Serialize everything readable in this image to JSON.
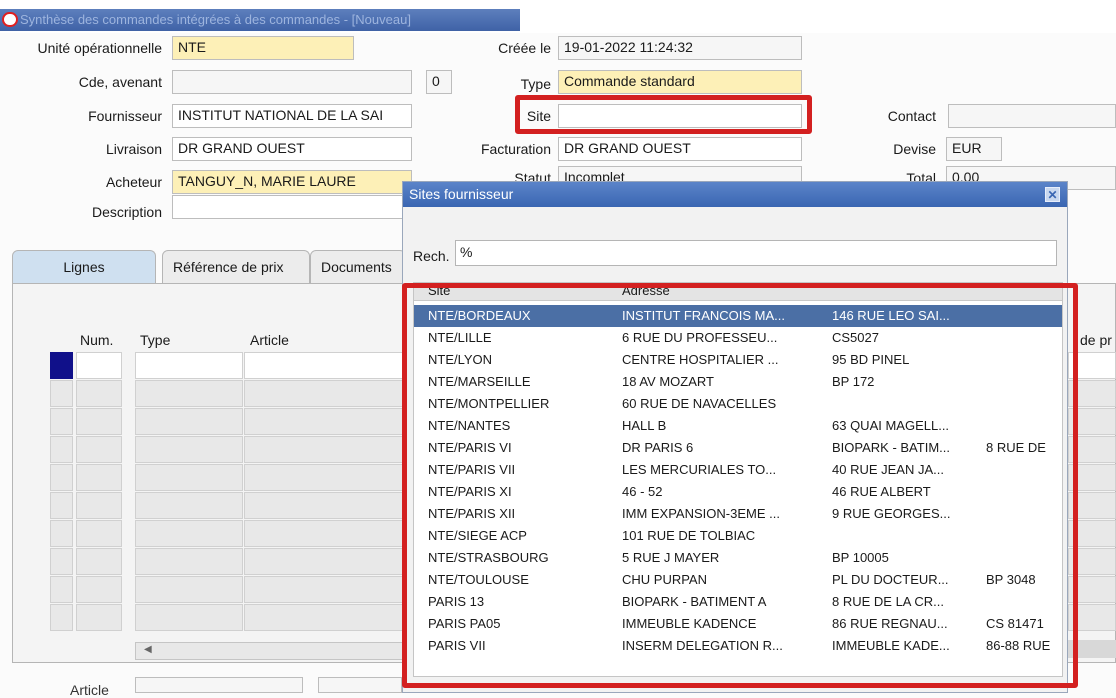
{
  "window": {
    "title": "Synthèse des commandes intégrées à des commandes - [Nouveau]"
  },
  "header": {
    "unite_label": "Unité opérationnelle",
    "unite_value": "NTE",
    "creee_label": "Créée le",
    "creee_value": "19-01-2022 11:24:32",
    "cde_label": "Cde, avenant",
    "cde_value": "",
    "avenant_value": "0",
    "type_label": "Type",
    "type_value": "Commande standard",
    "fournisseur_label": "Fournisseur",
    "fournisseur_value": "INSTITUT NATIONAL DE LA SAI",
    "site_label": "Site",
    "site_value": "",
    "contact_label": "Contact",
    "contact_value": "",
    "livraison_label": "Livraison",
    "livraison_value": "DR GRAND OUEST",
    "facturation_label": "Facturation",
    "facturation_value": "DR GRAND OUEST",
    "devise_label": "Devise",
    "devise_value": "EUR",
    "acheteur_label": "Acheteur",
    "acheteur_value": "TANGUY_N, MARIE LAURE",
    "statut_label": "Statut",
    "statut_value": "Incomplet",
    "total_label": "Total",
    "total_value": "0,00",
    "description_label": "Description",
    "description_value": ""
  },
  "tabs": [
    {
      "label": "Lignes"
    },
    {
      "label": "Référence de prix"
    },
    {
      "label": "Documents"
    }
  ],
  "grid": {
    "num": "Num.",
    "type": "Type",
    "article": "Article",
    "right_col": "de pr",
    "bottom_label": "Article"
  },
  "dialog": {
    "title": "Sites fournisseur",
    "search_label": "Rech.",
    "search_value": "%",
    "col_site": "Site",
    "col_adresse": "Adresse",
    "rows": [
      {
        "site": "NTE/BORDEAUX",
        "a1": "INSTITUT FRANCOIS MA...",
        "a2": "146 RUE LEO SAI...",
        "a3": ""
      },
      {
        "site": "NTE/LILLE",
        "a1": "6 RUE DU PROFESSEU...",
        "a2": "CS5027",
        "a3": ""
      },
      {
        "site": "NTE/LYON",
        "a1": "CENTRE HOSPITALIER ...",
        "a2": "95 BD PINEL",
        "a3": ""
      },
      {
        "site": "NTE/MARSEILLE",
        "a1": "18 AV MOZART",
        "a2": "BP 172",
        "a3": ""
      },
      {
        "site": "NTE/MONTPELLIER",
        "a1": "60 RUE DE NAVACELLES",
        "a2": "",
        "a3": ""
      },
      {
        "site": "NTE/NANTES",
        "a1": "HALL B",
        "a2": "63 QUAI MAGELL...",
        "a3": ""
      },
      {
        "site": "NTE/PARIS VI",
        "a1": "DR PARIS 6",
        "a2": "BIOPARK - BATIM...",
        "a3": "8 RUE DE"
      },
      {
        "site": "NTE/PARIS VII",
        "a1": "LES MERCURIALES TO...",
        "a2": "40 RUE JEAN JA...",
        "a3": ""
      },
      {
        "site": "NTE/PARIS XI",
        "a1": "46 - 52",
        "a2": "46 RUE ALBERT",
        "a3": ""
      },
      {
        "site": "NTE/PARIS XII",
        "a1": "IMM EXPANSION-3EME ...",
        "a2": "9 RUE GEORGES...",
        "a3": ""
      },
      {
        "site": "NTE/SIEGE ACP",
        "a1": "101 RUE DE TOLBIAC",
        "a2": "",
        "a3": ""
      },
      {
        "site": "NTE/STRASBOURG",
        "a1": "5 RUE J MAYER",
        "a2": "BP 10005",
        "a3": ""
      },
      {
        "site": "NTE/TOULOUSE",
        "a1": "CHU PURPAN",
        "a2": "PL DU DOCTEUR...",
        "a3": "BP 3048"
      },
      {
        "site": "PARIS 13",
        "a1": "BIOPARK - BATIMENT A",
        "a2": "8 RUE DE LA CR...",
        "a3": ""
      },
      {
        "site": "PARIS PA05",
        "a1": "IMMEUBLE KADENCE",
        "a2": "86 RUE REGNAU...",
        "a3": "CS 81471"
      },
      {
        "site": "PARIS VII",
        "a1": "INSERM DELEGATION R...",
        "a2": "IMMEUBLE KADE...",
        "a3": "86-88 RUE"
      }
    ]
  },
  "colors": {
    "highlight": "#d32020",
    "selection": "#4b6fa5",
    "required": "#fdf0b7"
  }
}
